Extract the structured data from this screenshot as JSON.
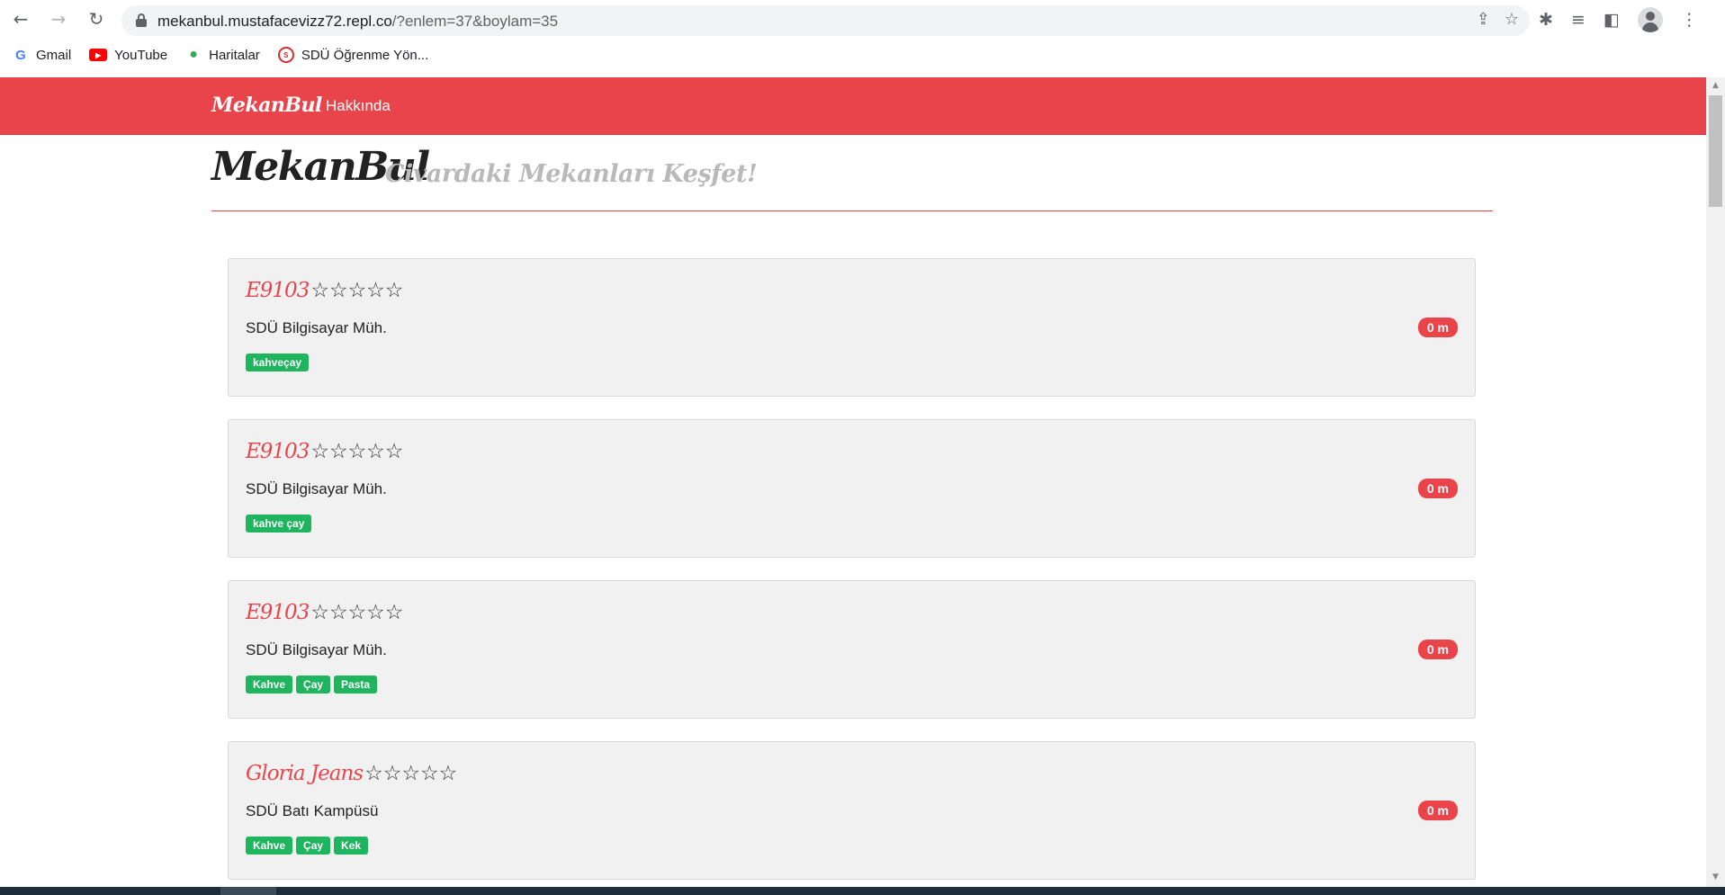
{
  "browser": {
    "url_host": "mekanbul.mustafacevizz72.repl.co",
    "url_path": "/?enlem=37&boylam=35",
    "bookmarks": [
      {
        "label": "Gmail",
        "icon": "google-icon"
      },
      {
        "label": "YouTube",
        "icon": "youtube-icon"
      },
      {
        "label": "Haritalar",
        "icon": "maps-pin-icon"
      },
      {
        "label": "SDÜ Öğrenme Yön...",
        "icon": "sdu-logo-icon"
      }
    ]
  },
  "navbar": {
    "brand": "MekanBul",
    "link_about": "Hakkında"
  },
  "header": {
    "title": "MekanBul",
    "subtitle": "Civardaki Mekanları Keşfet!"
  },
  "places": [
    {
      "name": "E9103",
      "stars": "☆☆☆☆☆",
      "address": "SDÜ Bilgisayar Müh.",
      "distance": "0 m",
      "tags": [
        "kahveçay"
      ]
    },
    {
      "name": "E9103",
      "stars": "☆☆☆☆☆",
      "address": "SDÜ Bilgisayar Müh.",
      "distance": "0 m",
      "tags": [
        "kahve çay"
      ]
    },
    {
      "name": "E9103",
      "stars": "☆☆☆☆☆",
      "address": "SDÜ Bilgisayar Müh.",
      "distance": "0 m",
      "tags": [
        "Kahve",
        "Çay",
        "Pasta"
      ]
    },
    {
      "name": "Gloria Jeans",
      "stars": "☆☆☆☆☆",
      "address": "SDÜ Batı Kampüsü",
      "distance": "0 m",
      "tags": [
        "Kahve",
        "Çay",
        "Kek"
      ]
    }
  ],
  "colors": {
    "accent": "#e9444a",
    "tag": "#1fb45e",
    "card_bg": "#f1f1f1"
  }
}
